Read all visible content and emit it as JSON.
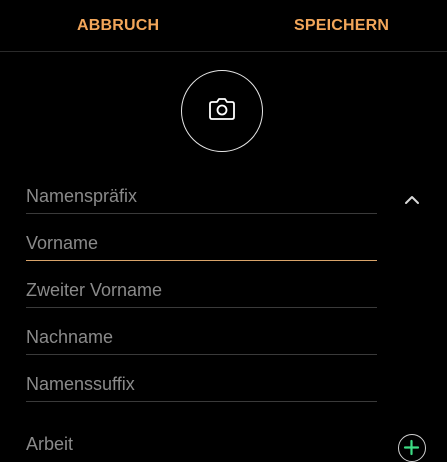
{
  "topbar": {
    "cancel_label": "ABBRUCH",
    "save_label": "SPEICHERN"
  },
  "photo": {
    "icon": "camera-icon"
  },
  "fields": {
    "prefix_placeholder": "Namenspräfix",
    "first_name_placeholder": "Vorname",
    "middle_name_placeholder": "Zweiter Vorname",
    "last_name_placeholder": "Nachname",
    "suffix_placeholder": "Namenssuffix"
  },
  "collapse_icon": "chevron-up-icon",
  "work_section": {
    "label": "Arbeit",
    "add_icon": "plus-circle-icon"
  },
  "colors": {
    "accent": "#F2A65A",
    "active_underline": "#D9A46A",
    "add_plus": "#3DDC84",
    "background": "#000000"
  }
}
